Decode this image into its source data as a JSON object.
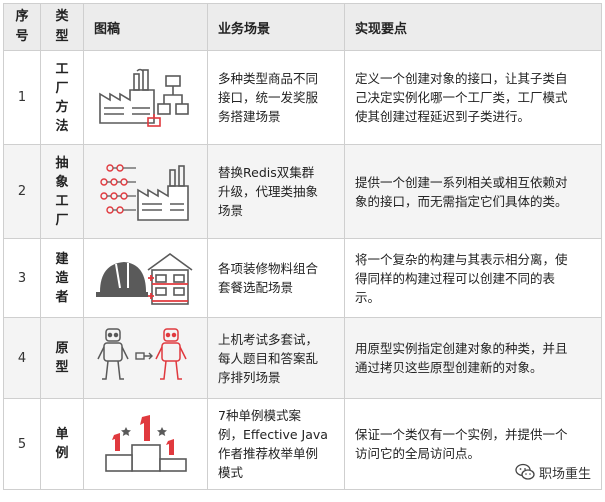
{
  "headers": {
    "no": [
      "序",
      "号"
    ],
    "type": [
      "类",
      "型"
    ],
    "pic": "图稿",
    "scene": "业务场景",
    "impl": "实现要点"
  },
  "rows": [
    {
      "no": "1",
      "type": [
        "工",
        "厂",
        "方",
        "法"
      ],
      "icon": "factory-flowchart-icon",
      "scene": [
        "多种类型商品不同",
        "接口，统一发奖服",
        "务搭建场景"
      ],
      "impl": [
        "定义一个创建对象的接口，让其子类自",
        "己决定实例化哪一个工厂类，工厂模式",
        "使其创建过程延迟到子类进行。"
      ]
    },
    {
      "no": "2",
      "type": [
        "抽",
        "象",
        "工",
        "厂"
      ],
      "icon": "factory-tree-icon",
      "scene": [
        "替换Redis双集群",
        "升级，代理类抽象",
        "场景"
      ],
      "impl": [
        "提供一个创建一系列相关或相互依赖对",
        "象的接口，而无需指定它们具体的类。"
      ]
    },
    {
      "no": "3",
      "type": [
        "建",
        "造",
        "者"
      ],
      "icon": "helmet-building-icon",
      "scene": [
        "各项装修物料组合",
        "套餐选配场景"
      ],
      "impl": [
        "将一个复杂的构建与其表示相分离，使",
        "得同样的构建过程可以创建不同的表",
        "示。"
      ]
    },
    {
      "no": "4",
      "type": [
        "原",
        "型"
      ],
      "icon": "robot-clone-icon",
      "scene": [
        "上机考试多套试，",
        "每人题目和答案乱",
        "序排列场景"
      ],
      "impl": [
        "用原型实例指定创建对象的种类，并且",
        "通过拷贝这些原型创建新的对象。"
      ]
    },
    {
      "no": "5",
      "type": [
        "单",
        "例"
      ],
      "icon": "podium-icon",
      "scene": [
        "7种单例模式案",
        "例，Effective Java",
        "作者推荐枚举单例",
        "模式"
      ],
      "impl": [
        "保证一个类仅有一个实例，并提供一个",
        "访问它的全局访问点。"
      ]
    }
  ],
  "watermark": "职场重生",
  "colors": {
    "accent_red": "#e0393e",
    "icon_gray": "#5a5a5a",
    "header_bg": "#ececec"
  }
}
